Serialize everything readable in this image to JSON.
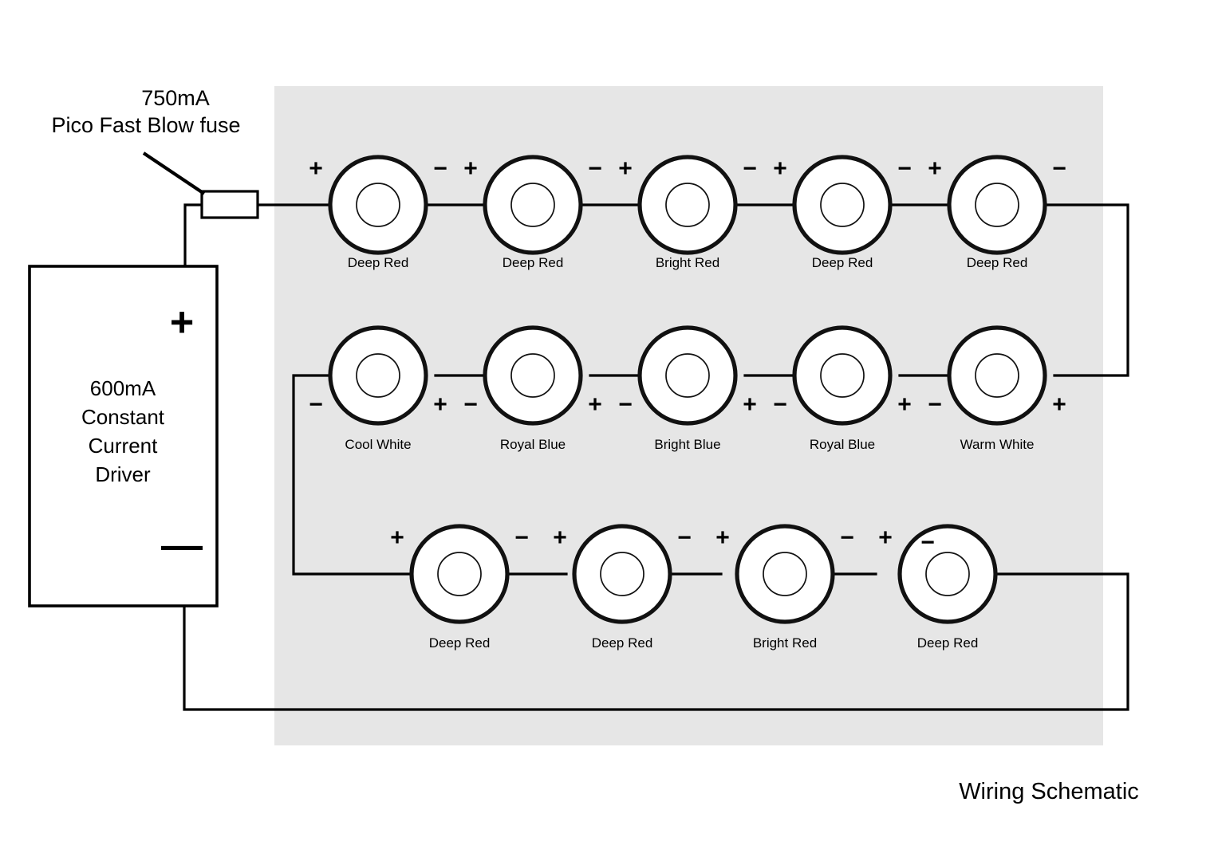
{
  "figure": {
    "caption": "Wiring Schematic",
    "panel_fill": "#e6e6e6",
    "wire_color": "#000000",
    "background": "#ffffff"
  },
  "fuse": {
    "label_line1": "750mA",
    "label_line2": "Pico Fast Blow fuse"
  },
  "driver": {
    "label_line1": "600mA",
    "label_line2": "Constant",
    "label_line3": "Current",
    "label_line4": "Driver",
    "positive_sign": "+",
    "negative_sign": "—"
  },
  "polarity": {
    "plus": "+",
    "minus": "−"
  },
  "strings": [
    {
      "row_id": "row-1",
      "leds": [
        {
          "label": "Deep Red",
          "left_sign": "+",
          "right_sign": "−"
        },
        {
          "label": "Deep Red",
          "left_sign": "+",
          "right_sign": "−"
        },
        {
          "label": "Bright Red",
          "left_sign": "+",
          "right_sign": "−"
        },
        {
          "label": "Deep Red",
          "left_sign": "+",
          "right_sign": "−"
        },
        {
          "label": "Deep Red",
          "left_sign": "+",
          "right_sign": "−"
        }
      ]
    },
    {
      "row_id": "row-2",
      "leds": [
        {
          "label": "Cool White",
          "left_sign": "−",
          "right_sign": "+"
        },
        {
          "label": "Royal Blue",
          "left_sign": "−",
          "right_sign": "+"
        },
        {
          "label": "Bright Blue",
          "left_sign": "−",
          "right_sign": "+"
        },
        {
          "label": "Royal Blue",
          "left_sign": "−",
          "right_sign": "+"
        },
        {
          "label": "Warm White",
          "left_sign": "−",
          "right_sign": "+"
        }
      ]
    },
    {
      "row_id": "row-3",
      "leds": [
        {
          "label": "Deep Red",
          "left_sign": "+",
          "right_sign": "−"
        },
        {
          "label": "Deep Red",
          "left_sign": "+",
          "right_sign": "−"
        },
        {
          "label": "Bright Red",
          "left_sign": "+",
          "right_sign": "−"
        },
        {
          "label": "Deep Red",
          "left_sign": "+",
          "right_sign": "−"
        }
      ]
    }
  ]
}
